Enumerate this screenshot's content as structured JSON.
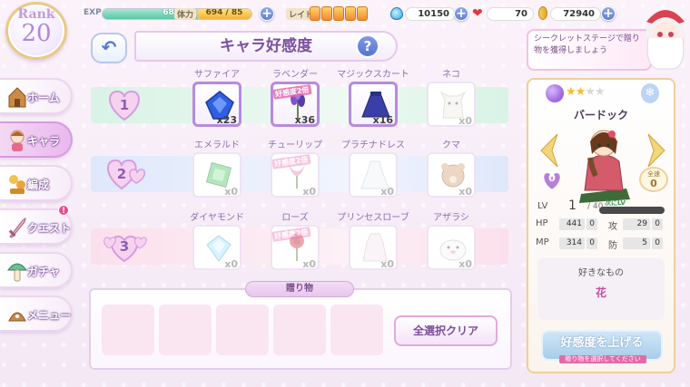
{
  "topbar": {
    "rank_label": "Rank",
    "rank_value": "20",
    "exp_label": "EXP",
    "exp_percent_text": "68%",
    "exp_fraction": 0.68,
    "stamina_label": "体力",
    "stamina_text": "694 / 85",
    "stamina_fraction": 1.0,
    "raid_label": "レイド",
    "raid_count": 5,
    "gems": "10150",
    "hearts": "70",
    "coins": "72940"
  },
  "notice": {
    "text": "シークレットステージで贈り物を獲得しましょう"
  },
  "nav": {
    "items": [
      {
        "label": "ホーム",
        "icon": "house-icon",
        "active": false
      },
      {
        "label": "キャラ",
        "icon": "character-icon",
        "active": true
      },
      {
        "label": "編成",
        "icon": "formation-icon",
        "active": false
      },
      {
        "label": "クエスト",
        "icon": "sword-icon",
        "active": false,
        "alert": "!"
      },
      {
        "label": "ガチャ",
        "icon": "mushroom-icon",
        "active": false
      },
      {
        "label": "メニュー",
        "icon": "menu-icon",
        "active": false
      }
    ]
  },
  "header": {
    "back_icon": "back-arrow-icon",
    "title": "キャラ好感度",
    "help_label": "?"
  },
  "gift_rows": [
    {
      "level": "1",
      "items": [
        {
          "name": "サファイア",
          "count": "x23",
          "owned": true,
          "selected": true,
          "icon": "sapphire-icon",
          "badge": ""
        },
        {
          "name": "ラベンダー",
          "count": "x36",
          "owned": true,
          "selected": true,
          "icon": "lavender-icon",
          "badge": "好感度2倍"
        },
        {
          "name": "マジックスカート",
          "count": "x16",
          "owned": true,
          "selected": true,
          "icon": "skirt-icon",
          "badge": ""
        },
        {
          "name": "ネコ",
          "count": "x0",
          "owned": false,
          "selected": false,
          "icon": "cat-icon",
          "badge": ""
        }
      ]
    },
    {
      "level": "2",
      "items": [
        {
          "name": "エメラルド",
          "count": "x0",
          "owned": false,
          "selected": false,
          "icon": "emerald-icon",
          "badge": ""
        },
        {
          "name": "チューリップ",
          "count": "x0",
          "owned": false,
          "selected": false,
          "icon": "tulip-icon",
          "badge": "好感度2倍"
        },
        {
          "name": "プラチナドレス",
          "count": "x0",
          "owned": false,
          "selected": false,
          "icon": "dress-icon",
          "badge": ""
        },
        {
          "name": "クマ",
          "count": "x0",
          "owned": false,
          "selected": false,
          "icon": "bear-icon",
          "badge": ""
        }
      ]
    },
    {
      "level": "3",
      "items": [
        {
          "name": "ダイヤモンド",
          "count": "x0",
          "owned": false,
          "selected": false,
          "icon": "diamond-icon",
          "badge": ""
        },
        {
          "name": "ローズ",
          "count": "x0",
          "owned": false,
          "selected": false,
          "icon": "rose-icon",
          "badge": "好感度2倍"
        },
        {
          "name": "プリンセスローブ",
          "count": "x0",
          "owned": false,
          "selected": false,
          "icon": "robe-icon",
          "badge": ""
        },
        {
          "name": "アザラシ",
          "count": "x0",
          "owned": false,
          "selected": false,
          "icon": "seal-icon",
          "badge": ""
        }
      ]
    }
  ],
  "gift_panel": {
    "title": "贈り物",
    "slots": 5,
    "select_clear_label": "全選択クリア"
  },
  "character": {
    "stars_filled": 2,
    "stars_total": 4,
    "name": "バードック",
    "affection_level": "0",
    "speed_label": "全速",
    "speed_value": "0",
    "lv_label": "LV",
    "lv_value": "1",
    "lv_max": "/ 40",
    "lv_bar_text": "次にLV",
    "lv_fraction": 0.0,
    "stats": [
      {
        "key": "HP",
        "value": "441",
        "bonus": "0",
        "key2": "攻",
        "value2": "29",
        "bonus2": "0"
      },
      {
        "key": "MP",
        "value": "314",
        "bonus": "0",
        "key2": "防",
        "value2": "5",
        "bonus2": "0"
      }
    ],
    "likes_title": "好きなもの",
    "likes_value": "花",
    "raise_label": "好感度を上げる",
    "raise_hint": "贈り物を選択してください"
  },
  "colors": {
    "accent_purple": "#b185dd",
    "row1": "#d9f3e6",
    "row2": "#dfe8fb",
    "row3": "#fbe0ec"
  }
}
